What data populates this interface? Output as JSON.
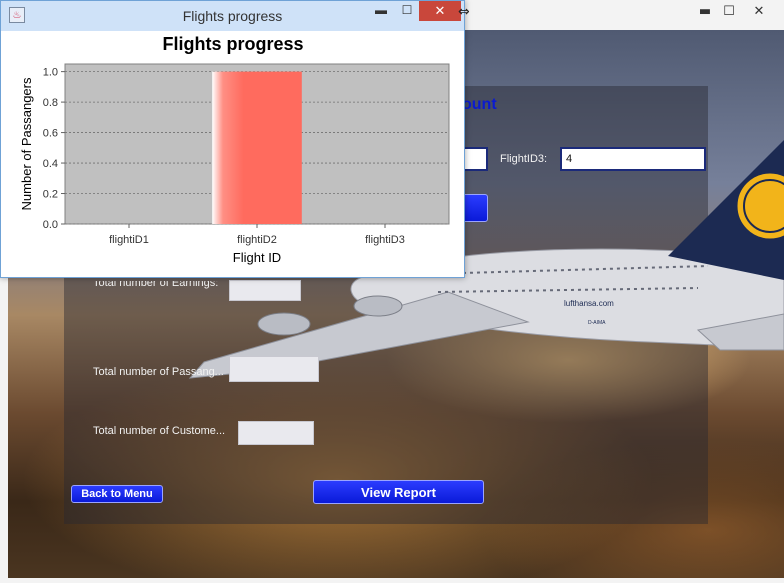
{
  "main_window": {
    "controls": {
      "minimize": "▬",
      "maximize": "☐",
      "close": "✕"
    },
    "heading_fragment": "ount",
    "flight_id3_label": "FlightID3:",
    "flight_id3_value": "4",
    "earnings_label": "Total number of Earnings:",
    "passengers_label": "Total number of Passang...",
    "customers_label": "Total number of Custome...",
    "back_button": "Back to Menu",
    "view_report_button": "View Report",
    "airline_text": "lufthansa.com",
    "registration": "D-AIMA"
  },
  "chart_window": {
    "title": "Flights progress",
    "icon": "app-icon",
    "controls": {
      "minimize": "▬",
      "maximize": "☐",
      "close": "✕"
    }
  },
  "chart_data": {
    "type": "bar",
    "title": "Flights progress",
    "xlabel": "Flight ID",
    "ylabel": "Number of Passangers",
    "categories": [
      "flightiD1",
      "flightiD2",
      "flightiD3"
    ],
    "values": [
      0,
      1.0,
      0
    ],
    "ylim": [
      0,
      1.05
    ],
    "yticks": [
      "0.0",
      "0.2",
      "0.4",
      "0.6",
      "0.8",
      "1.0"
    ],
    "grid": true,
    "bar_color": "#ff6b5e",
    "plot_background": "#c0c0c0"
  }
}
